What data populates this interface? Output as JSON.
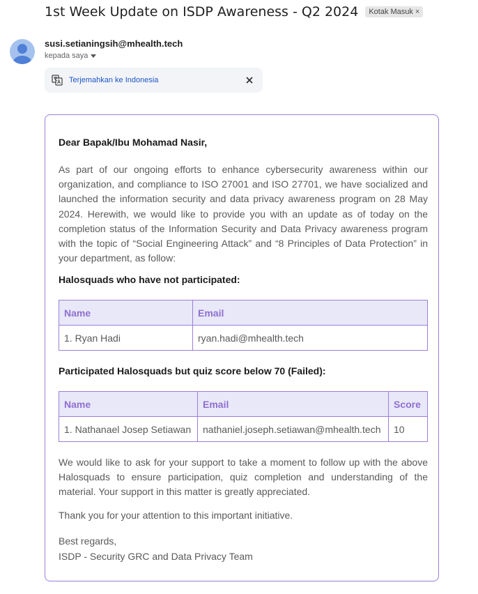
{
  "email": {
    "subject": "1st Week Update on ISDP Awareness - Q2 2024",
    "label_badge": "Kotak Masuk",
    "sender": "susi.setianingsih@mhealth.tech",
    "recipient_text": "kepada saya",
    "translate_link": "Terjemahkan ke Indonesia"
  },
  "body": {
    "greeting": "Dear Bapak/Ibu Mohamad Nasir,",
    "paragraph1": "As part of our ongoing efforts to enhance cybersecurity awareness within our organization, and compliance to ISO 27001 and ISO 27701, we have socialized and launched the information security and data privacy awareness program on 28 May 2024. Herewith, we would like to provide you with an update as of today on the completion status of the Information Security and Data Privacy awareness program with the topic of “Social Engineering Attack” and “8 Principles of Data Protection” in your department, as follow:",
    "heading_not_participated": "Halosquads who have not participated:",
    "table1": {
      "headers": [
        "Name",
        "Email"
      ],
      "rows": [
        [
          "1. Ryan Hadi",
          "ryan.hadi@mhealth.tech"
        ]
      ]
    },
    "heading_failed": "Participated Halosquads but quiz score below 70 (Failed):",
    "table2": {
      "headers": [
        "Name",
        "Email",
        "Score"
      ],
      "rows": [
        [
          "1. Nathanael Josep Setiawan",
          "nathaniel.joseph.setiawan@mhealth.tech",
          "10"
        ]
      ]
    },
    "paragraph2": "We would like to ask for your support to take a moment to follow up with the above Halosquads to ensure participation, quiz completion and understanding of the material. Your support in this matter is greatly appreciated.",
    "paragraph3": "Thank you for your attention to this important initiative.",
    "closing": "Best regards,",
    "signature": "ISDP - Security GRC and Data Privacy Team"
  }
}
